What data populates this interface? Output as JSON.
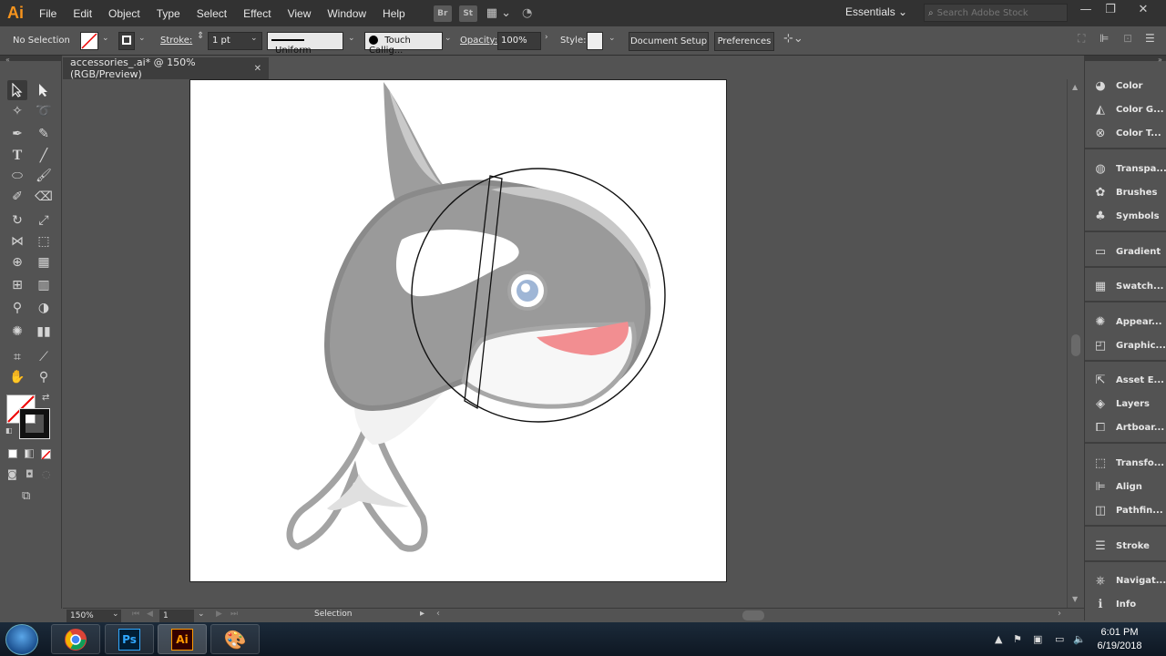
{
  "app": {
    "logo": "Ai",
    "menus": [
      "File",
      "Edit",
      "Object",
      "Type",
      "Select",
      "Effect",
      "View",
      "Window",
      "Help"
    ],
    "bridge_label": "Br",
    "stock_label": "St",
    "workspace": "Essentials",
    "search_placeholder": "Search Adobe Stock"
  },
  "control_bar": {
    "selection_status": "No Selection",
    "stroke_label": "Stroke:",
    "stroke_weight": "1 pt",
    "stroke_profile": "Uniform",
    "brush": "Touch Callig...",
    "opacity_label": "Opacity:",
    "opacity_value": "100%",
    "style_label": "Style:",
    "document_setup": "Document Setup",
    "preferences": "Preferences"
  },
  "document": {
    "tab_title": "accessories_.ai* @ 150% (RGB/Preview)"
  },
  "panels": [
    {
      "label": "Color",
      "icon": "color-icon"
    },
    {
      "label": "Color G...",
      "icon": "color-guide-icon"
    },
    {
      "label": "Color T...",
      "icon": "color-themes-icon"
    },
    {
      "label": "Transpa...",
      "icon": "transparency-icon"
    },
    {
      "label": "Brushes",
      "icon": "brushes-icon"
    },
    {
      "label": "Symbols",
      "icon": "symbols-icon"
    },
    {
      "label": "Gradient",
      "icon": "gradient-icon"
    },
    {
      "label": "Swatch...",
      "icon": "swatches-icon"
    },
    {
      "label": "Appear...",
      "icon": "appearance-icon"
    },
    {
      "label": "Graphic...",
      "icon": "graphic-styles-icon"
    },
    {
      "label": "Asset E...",
      "icon": "asset-export-icon"
    },
    {
      "label": "Layers",
      "icon": "layers-icon"
    },
    {
      "label": "Artboar...",
      "icon": "artboards-icon"
    },
    {
      "label": "Transfo...",
      "icon": "transform-icon"
    },
    {
      "label": "Align",
      "icon": "align-icon"
    },
    {
      "label": "Pathfin...",
      "icon": "pathfinder-icon"
    },
    {
      "label": "Stroke",
      "icon": "stroke-icon"
    },
    {
      "label": "Navigat...",
      "icon": "navigator-icon"
    },
    {
      "label": "Info",
      "icon": "info-icon"
    }
  ],
  "status_bar": {
    "zoom": "150%",
    "artboard_number": "1",
    "current_tool": "Selection"
  },
  "taskbar": {
    "time": "6:01 PM",
    "date": "6/19/2018",
    "ps_label": "Ps",
    "ai_label": "Ai"
  }
}
